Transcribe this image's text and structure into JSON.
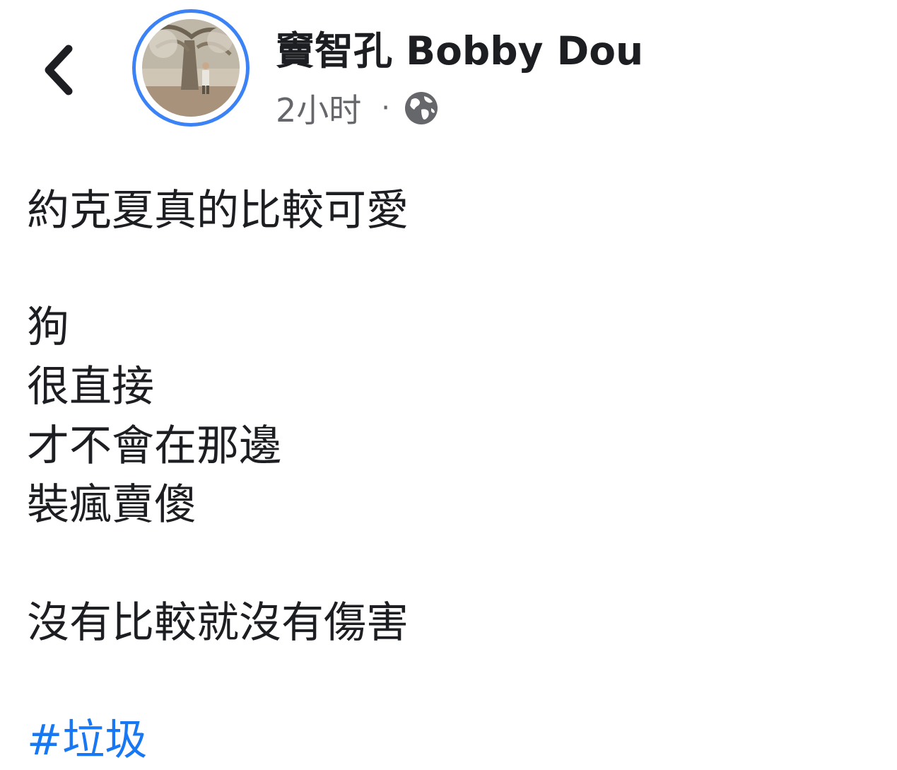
{
  "post": {
    "author_name": "竇智孔 Bobby Dou",
    "timestamp": "2小时",
    "separator": "·",
    "privacy_icon": "globe-icon",
    "back_icon": "chevron-left-icon",
    "lines": {
      "l1": "約克夏真的比較可愛",
      "l2": "狗",
      "l3": "很直接",
      "l4": "才不會在那邊",
      "l5": "裝瘋賣傻",
      "l6": "沒有比較就沒有傷害"
    },
    "hashtag": "#垃圾"
  },
  "colors": {
    "avatar_ring": "#3b82f6",
    "hashtag": "#1877f2",
    "meta_text": "#65676b"
  }
}
